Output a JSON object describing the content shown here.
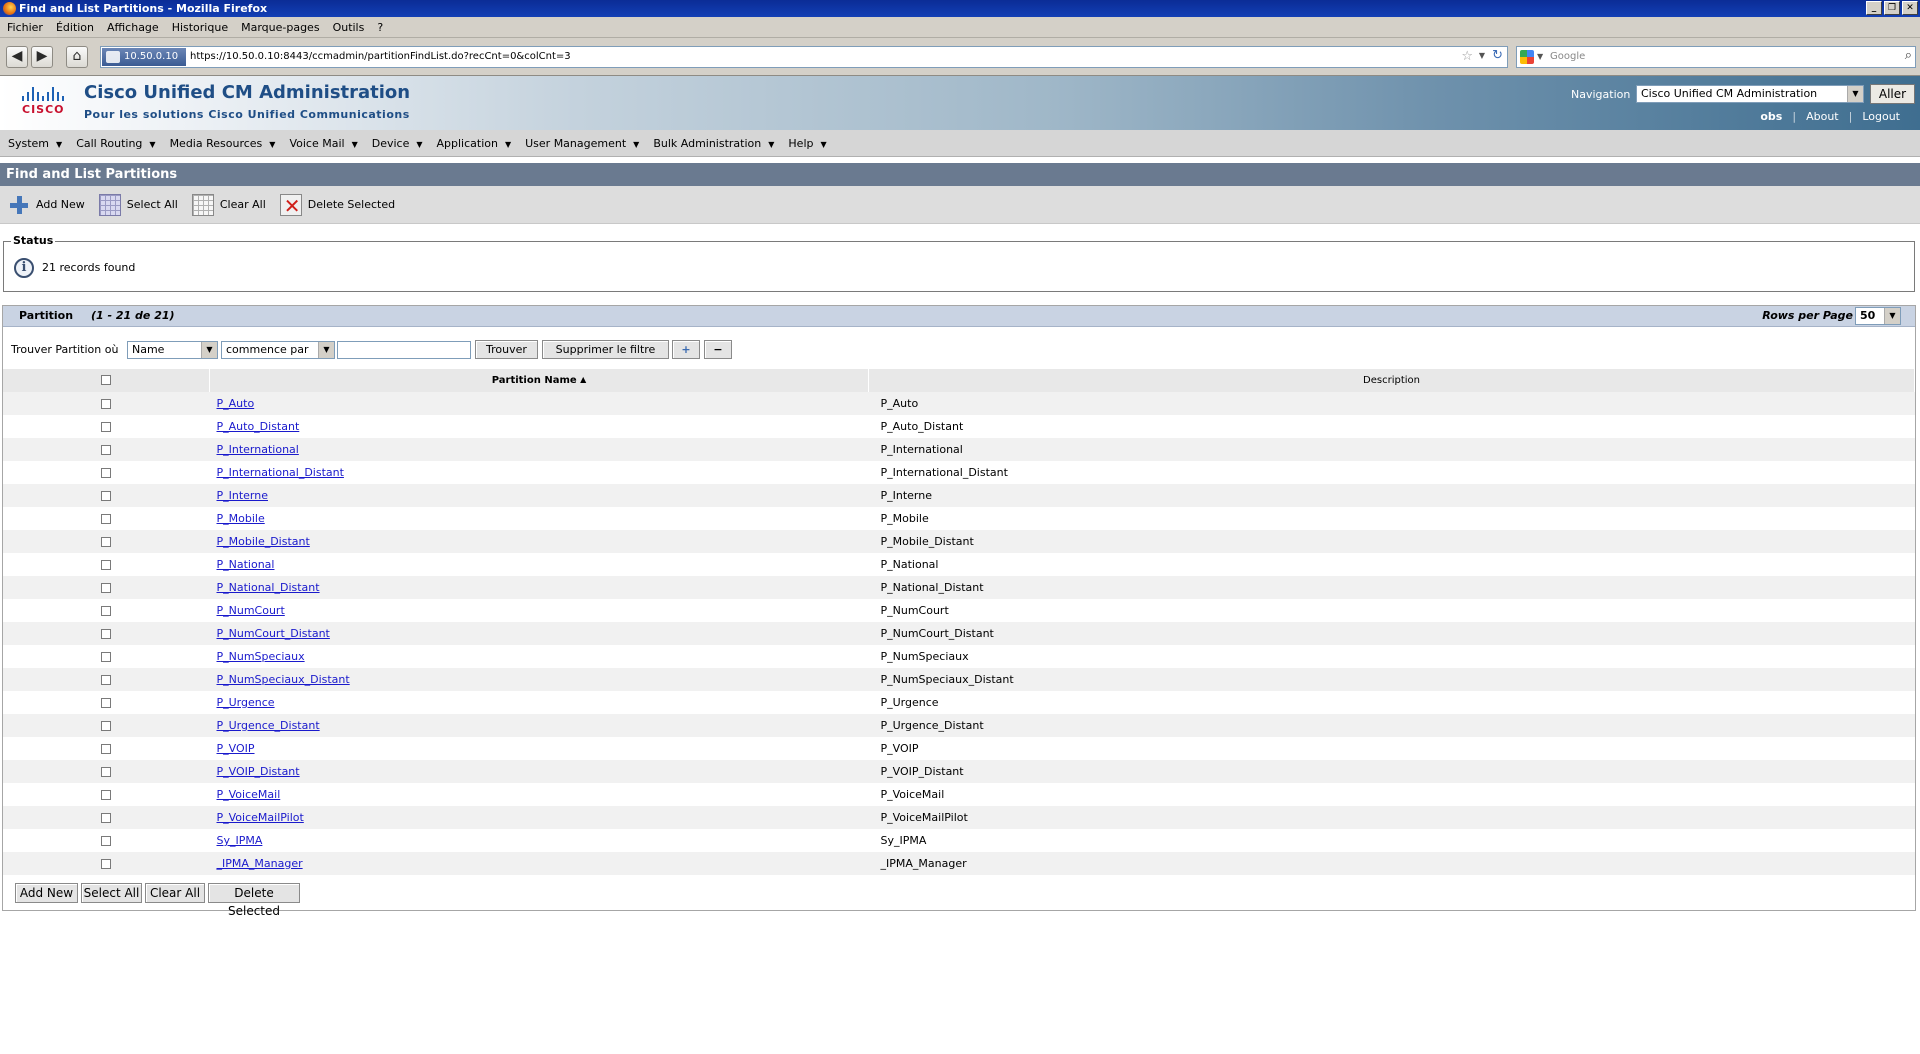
{
  "window": {
    "title": "Find and List Partitions - Mozilla Firefox",
    "controls": [
      "_",
      "❐",
      "✕"
    ]
  },
  "browser_menu": [
    "Fichier",
    "Édition",
    "Affichage",
    "Historique",
    "Marque-pages",
    "Outils",
    "?"
  ],
  "address_bar": {
    "identity": "10.50.0.10",
    "url": "https://10.50.0.10:8443/ccmadmin/partitionFindList.do?recCnt=0&colCnt=3"
  },
  "search_bar": {
    "placeholder": "Google"
  },
  "banner": {
    "brand": "CISCO",
    "title": "Cisco Unified CM Administration",
    "subtitle": "Pour les solutions Cisco Unified Communications",
    "navigation_label": "Navigation",
    "navigation_value": "Cisco Unified CM Administration",
    "go_label": "Aller",
    "user": "obs",
    "about": "About",
    "logout": "Logout"
  },
  "main_menu": [
    "System",
    "Call Routing",
    "Media Resources",
    "Voice Mail",
    "Device",
    "Application",
    "User Management",
    "Bulk Administration",
    "Help"
  ],
  "page": {
    "title": "Find and List Partitions",
    "toolbar": {
      "add_new": "Add New",
      "select_all": "Select All",
      "clear_all": "Clear All",
      "delete_selected": "Delete Selected"
    }
  },
  "status": {
    "legend": "Status",
    "message": "21 records found"
  },
  "results": {
    "title": "Partition",
    "range": "(1 - 21 de 21)",
    "rows_per_page_label": "Rows per Page",
    "rows_per_page": "50",
    "find_label": "Trouver Partition où",
    "field": "Name",
    "operator": "commence par",
    "search_value": "",
    "find_button": "Trouver",
    "clear_filter_button": "Supprimer le filtre",
    "add_criteria": "+",
    "remove_criteria": "−",
    "columns": [
      "Partition Name",
      "Description"
    ],
    "sort_indicator": "▲",
    "rows": [
      {
        "name": "P_Auto",
        "description": "P_Auto"
      },
      {
        "name": "P_Auto_Distant",
        "description": "P_Auto_Distant"
      },
      {
        "name": "P_International",
        "description": "P_International"
      },
      {
        "name": "P_International_Distant",
        "description": "P_International_Distant"
      },
      {
        "name": "P_Interne",
        "description": "P_Interne"
      },
      {
        "name": "P_Mobile",
        "description": "P_Mobile"
      },
      {
        "name": "P_Mobile_Distant",
        "description": "P_Mobile_Distant"
      },
      {
        "name": "P_National",
        "description": "P_National"
      },
      {
        "name": "P_National_Distant",
        "description": "P_National_Distant"
      },
      {
        "name": "P_NumCourt",
        "description": "P_NumCourt"
      },
      {
        "name": "P_NumCourt_Distant",
        "description": "P_NumCourt_Distant"
      },
      {
        "name": "P_NumSpeciaux",
        "description": "P_NumSpeciaux"
      },
      {
        "name": "P_NumSpeciaux_Distant",
        "description": "P_NumSpeciaux_Distant"
      },
      {
        "name": "P_Urgence",
        "description": "P_Urgence"
      },
      {
        "name": "P_Urgence_Distant",
        "description": "P_Urgence_Distant"
      },
      {
        "name": "P_VOIP",
        "description": "P_VOIP"
      },
      {
        "name": "P_VOIP_Distant",
        "description": "P_VOIP_Distant"
      },
      {
        "name": "P_VoiceMail",
        "description": "P_VoiceMail"
      },
      {
        "name": "P_VoiceMailPilot",
        "description": "P_VoiceMailPilot"
      },
      {
        "name": "Sy_IPMA",
        "description": "Sy_IPMA"
      },
      {
        "name": "_IPMA_Manager",
        "description": "_IPMA_Manager"
      }
    ],
    "bottom_buttons": {
      "add_new": "Add New",
      "select_all": "Select All",
      "clear_all": "Clear All",
      "delete_selected": "Delete Selected"
    }
  },
  "colors": {
    "title_bar": "#0b2c96",
    "banner_title": "#1f4e86",
    "page_header": "#6a7a90",
    "link": "#1a1acc",
    "cisco_red": "#c8102e"
  }
}
